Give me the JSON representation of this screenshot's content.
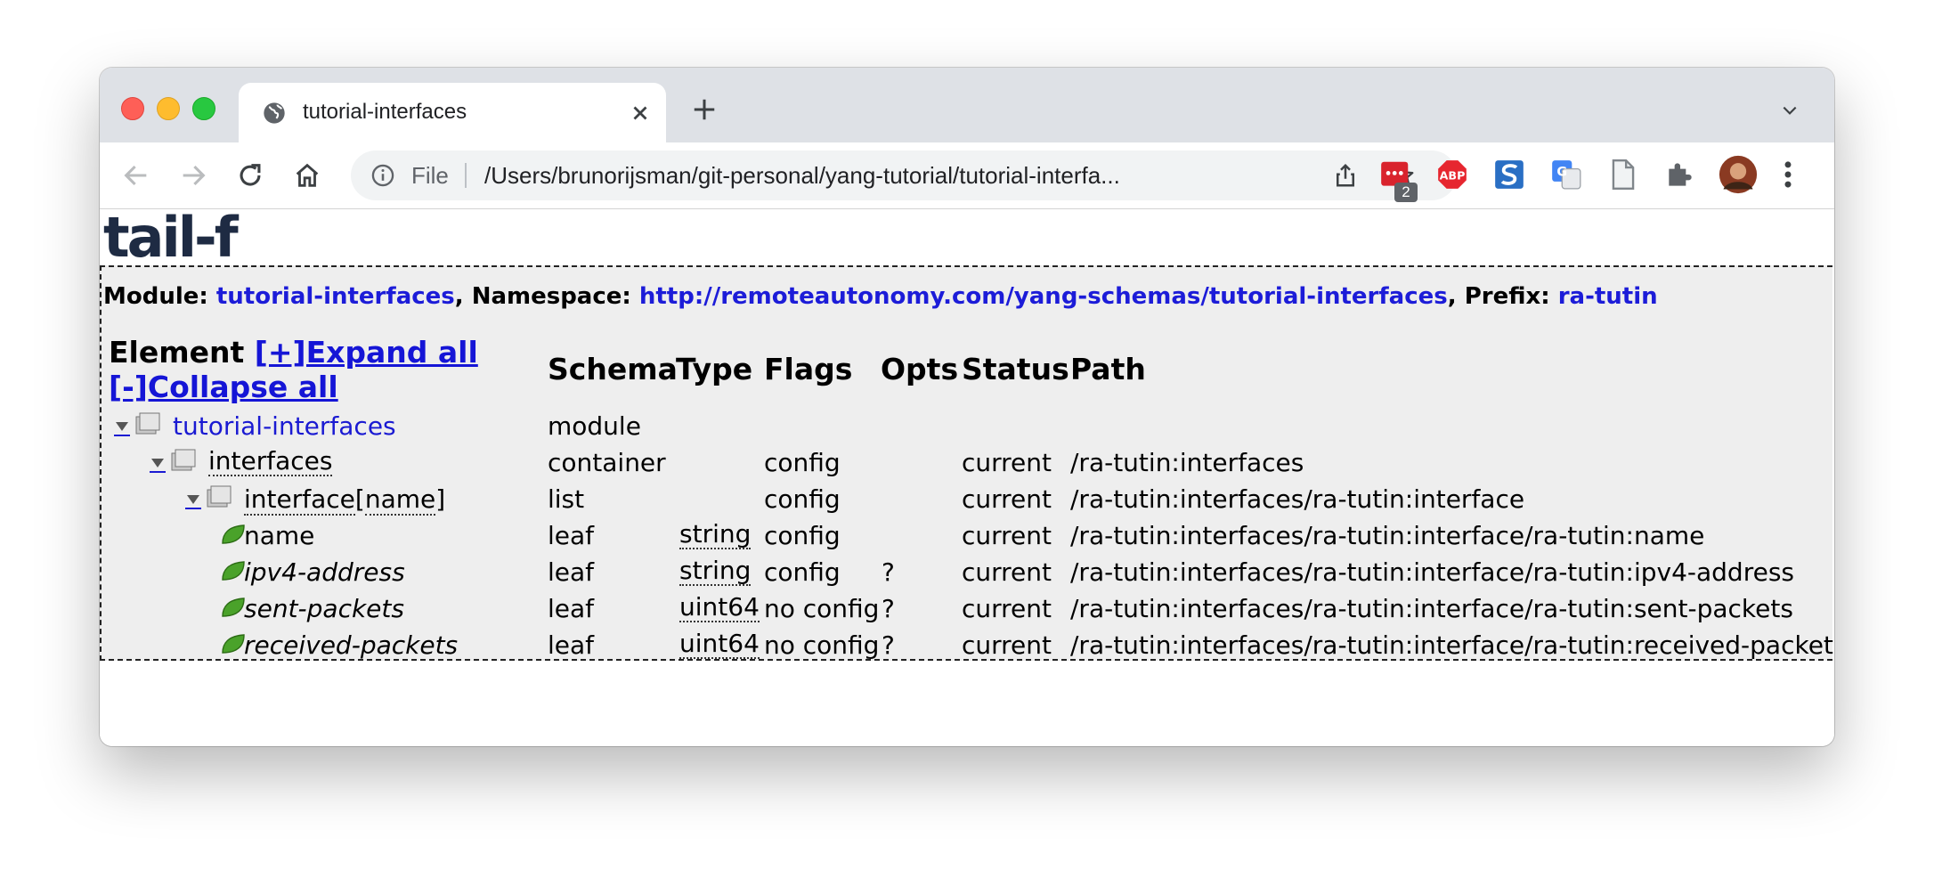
{
  "browser": {
    "tab_title": "tutorial-interfaces",
    "address_scheme": "File",
    "address_url": "/Users/brunorijsman/git-personal/yang-tutorial/tutorial-interfa...",
    "extension_badge": "2",
    "extensions": [
      "meetup-icon",
      "adblock-icon",
      "s-icon",
      "translate-icon",
      "document-icon",
      "puzzle-icon",
      "avatar"
    ]
  },
  "page": {
    "logo_text": "tail-f",
    "module_line": {
      "module_label": "Module: ",
      "module_value": "tutorial-interfaces",
      "namespace_label": ", Namespace: ",
      "namespace_value": "http://remoteautonomy.com/yang-schemas/tutorial-interfaces",
      "prefix_label": ", Prefix: ",
      "prefix_value": "ra-tutin"
    },
    "header": {
      "element": "Element ",
      "expand_all": "[+]Expand all",
      "collapse_all": "[-]Collapse all",
      "schema": "Schema",
      "type": "Type",
      "flags": "Flags",
      "opts": "Opts",
      "status": "Status",
      "path": "Path"
    },
    "rows": [
      {
        "name": "tutorial-interfaces",
        "schema": "module",
        "type": "",
        "flags": "",
        "opts": "",
        "status": "",
        "path": ""
      },
      {
        "name": "interfaces",
        "schema": "container",
        "type": "",
        "flags": "config",
        "opts": "",
        "status": "current",
        "path": "/ra-tutin:interfaces"
      },
      {
        "name_main": "interface",
        "name_open": "[",
        "name_key": "name",
        "name_close": "]",
        "schema": "list",
        "type": "",
        "flags": "config",
        "opts": "",
        "status": "current",
        "path": "/ra-tutin:interfaces/ra-tutin:interface"
      },
      {
        "name": "name",
        "schema": "leaf",
        "type": "string",
        "flags": "config",
        "opts": "",
        "status": "current",
        "path": "/ra-tutin:interfaces/ra-tutin:interface/ra-tutin:name"
      },
      {
        "name": "ipv4-address",
        "schema": "leaf",
        "type": "string",
        "flags": "config",
        "opts": "?",
        "status": "current",
        "path": "/ra-tutin:interfaces/ra-tutin:interface/ra-tutin:ipv4-address"
      },
      {
        "name": "sent-packets",
        "schema": "leaf",
        "type": "uint64",
        "flags": "no config",
        "opts": "?",
        "status": "current",
        "path": "/ra-tutin:interfaces/ra-tutin:interface/ra-tutin:sent-packets"
      },
      {
        "name": "received-packets",
        "schema": "leaf",
        "type": "uint64",
        "flags": "no config",
        "opts": "?",
        "status": "current",
        "path": "/ra-tutin:interfaces/ra-tutin:interface/ra-tutin:received-packets"
      }
    ]
  }
}
